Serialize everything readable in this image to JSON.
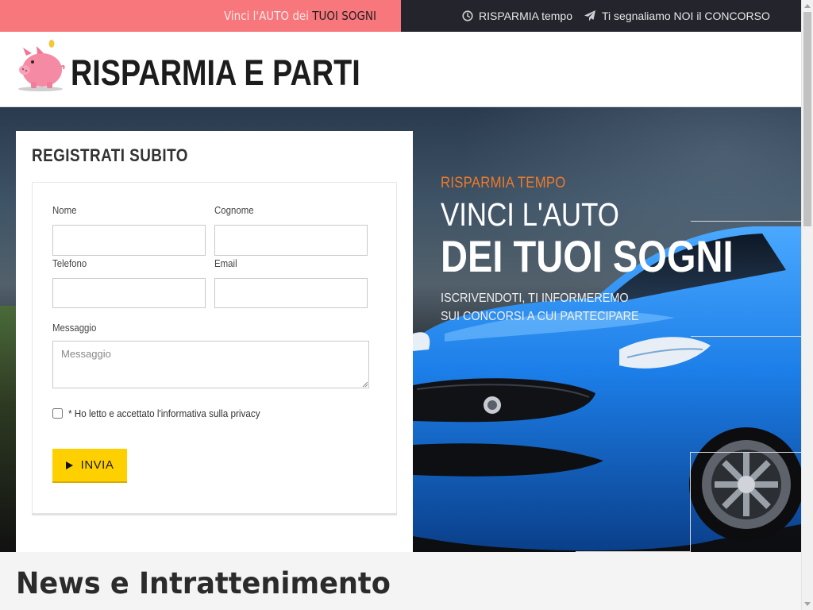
{
  "topbar": {
    "promo_prefix": "Vinci l'AUTO dei ",
    "promo_highlight": "TUOI SOGNI",
    "item1_label": "RISPARMIA tempo",
    "item1_icon": "clock-icon",
    "item2_label": "Ti segnaliamo NOI il CONCORSO",
    "item2_icon": "paper-plane-icon",
    "colors": {
      "promo_bg": "#f7777c",
      "dark_bg": "#23242c"
    }
  },
  "header": {
    "logo_icon": "piggy-bank-icon",
    "logo_text": "RISPARMIA E PARTI"
  },
  "hero": {
    "kicker": "RISPARMIA TEMPO",
    "title_line1": "VINCI L'AUTO",
    "title_line2": "DEI TUOI SOGNI",
    "sub_line1": "ISCRIVENDOTI, TI INFORMEREMO",
    "sub_line2": "SUI CONCORSI A CUI PARTECIPARE",
    "colors": {
      "kicker": "#ee7a2a"
    }
  },
  "form": {
    "title": "REGISTRATI SUBITO",
    "fields": {
      "nome": {
        "label": "Nome",
        "value": ""
      },
      "cognome": {
        "label": "Cognome",
        "value": ""
      },
      "telefono": {
        "label": "Telefono",
        "value": ""
      },
      "email": {
        "label": "Email",
        "value": ""
      },
      "messaggio": {
        "label": "Messaggio",
        "placeholder": "Messaggio",
        "value": ""
      }
    },
    "privacy_label": "* Ho letto e accettato l'informativa sulla privacy",
    "submit_label": "INVIA",
    "colors": {
      "submit_bg": "#ffd000"
    }
  },
  "news": {
    "title": "News e Intrattenimento"
  }
}
